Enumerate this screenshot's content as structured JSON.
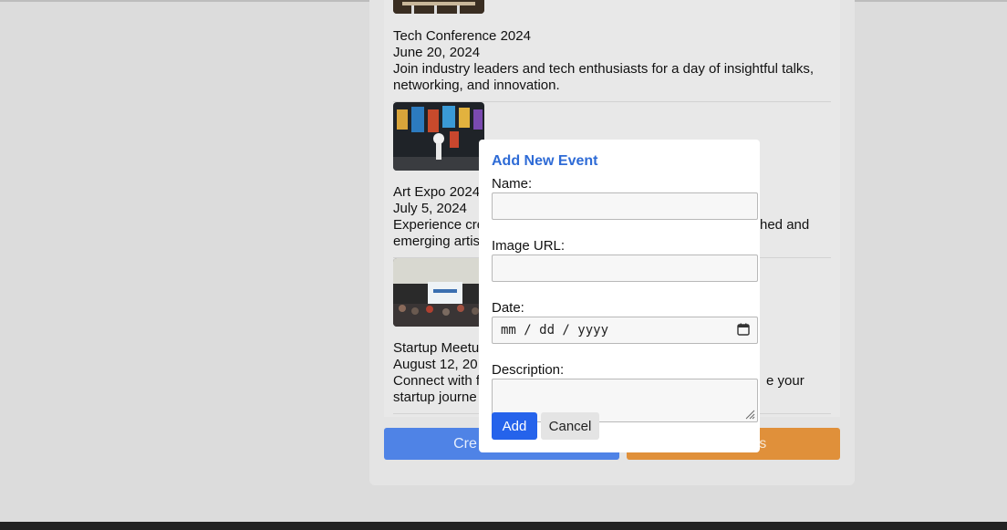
{
  "events": [
    {
      "name": "Tech Conference 2024",
      "date": "June 20, 2024",
      "description": "Join industry leaders and tech enthusiasts for a day of insightful talks, networking, and innovation."
    },
    {
      "name": "Art Expo 2024",
      "date": "July 5, 2024",
      "description_left": "Experience cre",
      "description_right": "hed and",
      "description_line2": "emerging artis"
    },
    {
      "name": "Startup Meetu",
      "date": "August 12, 20",
      "description_left": "Connect with f",
      "description_right": "e your",
      "description_line2": "startup journe"
    }
  ],
  "buttons": {
    "create_visible": "Cre",
    "orange_visible": "ts"
  },
  "modal": {
    "title": "Add New Event",
    "name_label": "Name:",
    "image_label": "Image URL:",
    "date_label": "Date:",
    "date_placeholder": "mm / dd / yyyy",
    "description_label": "Description:",
    "add_label": "Add",
    "cancel_label": "Cancel"
  },
  "colors": {
    "accent": "#2e6bd6",
    "add_button": "#2563eb",
    "create_button": "#4f83e6",
    "orange_button": "#e0903a"
  }
}
